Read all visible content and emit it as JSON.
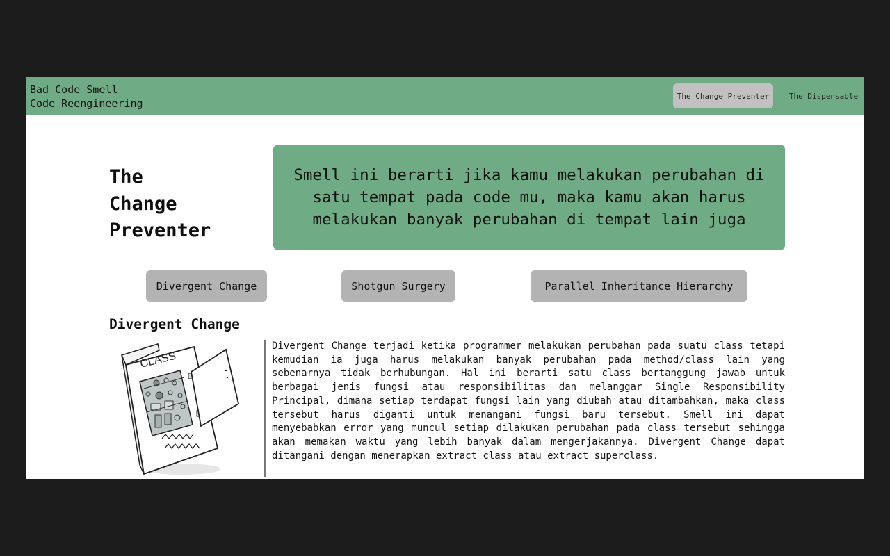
{
  "navbar": {
    "brand_line1": "Bad Code Smell",
    "brand_line2": "Code Reengineering",
    "links": [
      {
        "label": "The Change Preventer",
        "active": true
      },
      {
        "label": "The Dispensable",
        "active": false
      }
    ]
  },
  "hero": {
    "title_line1": "The",
    "title_line2": "Change",
    "title_line3": "Preventer",
    "description": "Smell ini berarti jika kamu melakukan perubahan di satu tempat pada code mu, maka kamu akan harus melakukan banyak perubahan di tempat lain juga"
  },
  "topics": [
    {
      "label": "Divergent Change"
    },
    {
      "label": "Shotgun Surgery"
    },
    {
      "label": "Parallel Inheritance Hierarchy"
    }
  ],
  "section": {
    "heading": "Divergent Change",
    "illustration_label": "CLASS",
    "body": "Divergent Change terjadi ketika programmer melakukan perubahan pada suatu class tetapi kemudian ia juga harus melakukan banyak perubahan pada method/class lain yang sebenarnya tidak berhubungan. Hal ini berarti satu class bertanggung jawab untuk berbagai jenis fungsi atau responsibilitas dan melanggar Single Responsibility Principal, dimana setiap terdapat fungsi lain yang diubah atau ditambahkan, maka class tersebut harus diganti untuk menangani fungsi baru tersebut. Smell ini dapat menyebabkan error yang muncul setiap dilakukan perubahan pada class tersebut sehingga akan memakan waktu yang lebih banyak dalam mengerjakannya. Divergent Change dapat ditangani dengan menerapkan extract class atau extract superclass."
  },
  "colors": {
    "accent_green": "#6fab84",
    "button_gray": "#b3b3b3",
    "active_nav_gray": "#c1c1c1",
    "backdrop": "#1c1c1c"
  },
  "icons": {
    "illustration": "class-box-illustration"
  }
}
